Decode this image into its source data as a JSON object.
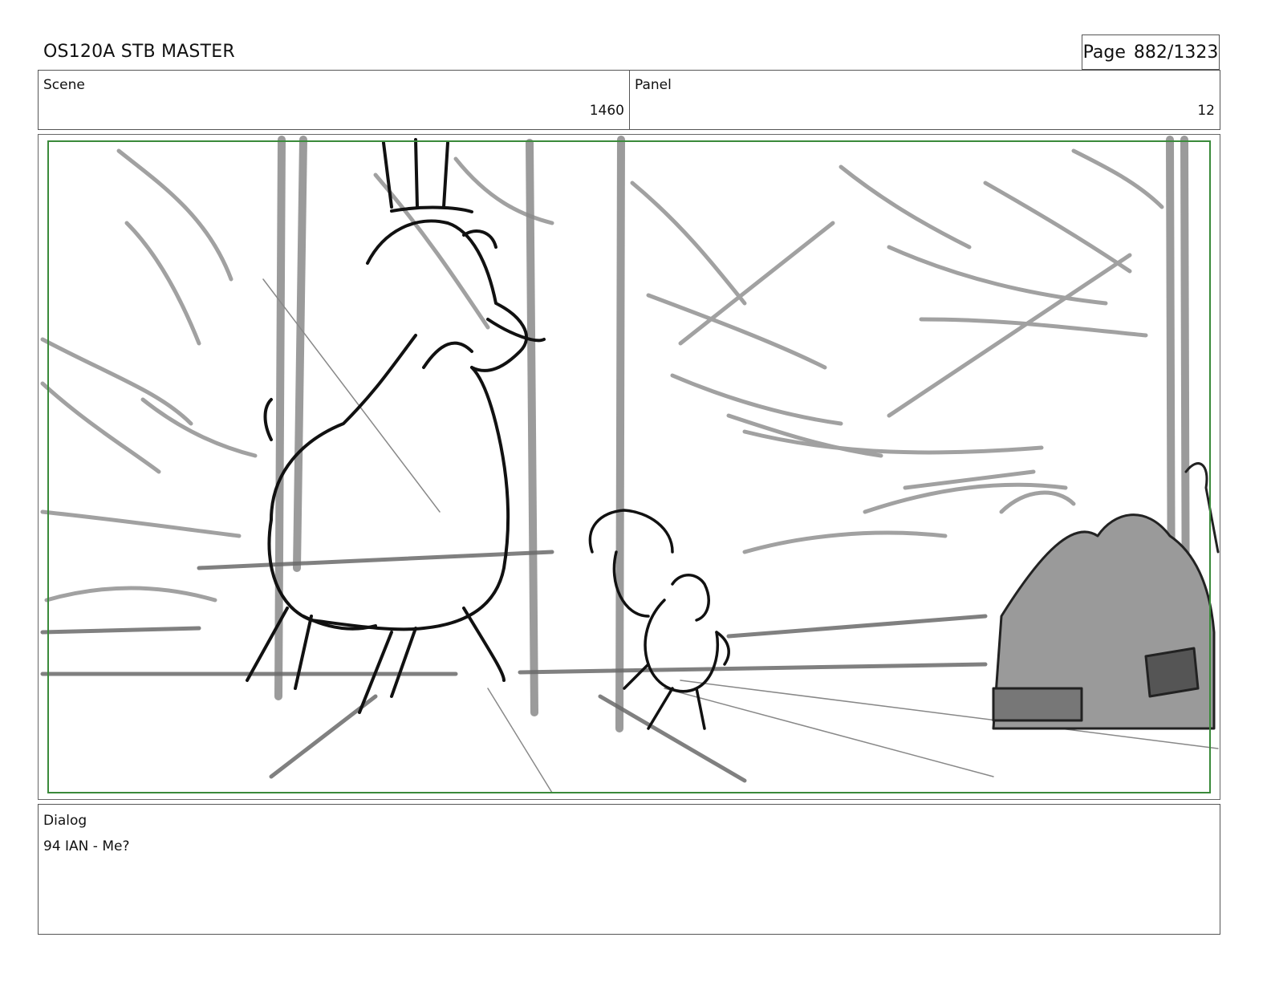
{
  "header": {
    "title": "OS120A STB MASTER",
    "page_label": "Page",
    "page_value": "882/1323"
  },
  "scene": {
    "label": "Scene",
    "value": "1460"
  },
  "panel": {
    "label": "Panel",
    "value": "12"
  },
  "dialog": {
    "label": "Dialog",
    "text": "94 IAN - Me?"
  },
  "colors": {
    "safe_frame": "#3a8a3a",
    "sketch_gray": "#7a7a7a",
    "ink": "#111111"
  }
}
